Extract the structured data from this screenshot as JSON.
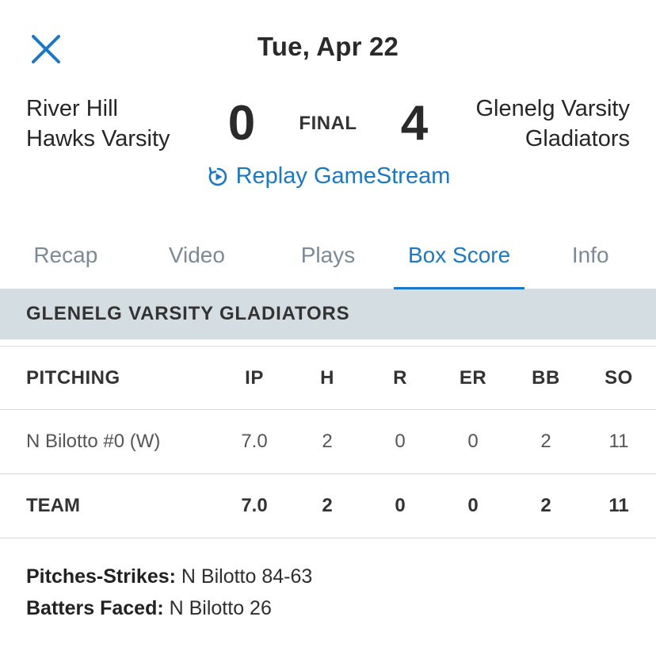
{
  "header": {
    "close_icon": "close-icon",
    "date": "Tue, Apr 22"
  },
  "game": {
    "away": {
      "line1": "River Hill",
      "line2": "Hawks Varsity",
      "score": "0"
    },
    "home": {
      "line1": "Glenelg Varsity",
      "line2": "Gladiators",
      "score": "4"
    },
    "status": "FINAL",
    "replay_label": "Replay GameStream",
    "replay_icon": "replay-icon"
  },
  "tabs": [
    {
      "label": "Recap"
    },
    {
      "label": "Video"
    },
    {
      "label": "Plays"
    },
    {
      "label": "Box Score"
    },
    {
      "label": "Info"
    }
  ],
  "active_tab": "Box Score",
  "section": {
    "title": "GLENELG VARSITY GLADIATORS"
  },
  "pitching": {
    "columns": [
      "PITCHING",
      "IP",
      "H",
      "R",
      "ER",
      "BB",
      "SO"
    ],
    "rows": [
      [
        "N Bilotto #0 (W)",
        "7.0",
        "2",
        "0",
        "0",
        "2",
        "11"
      ]
    ],
    "team": [
      "TEAM",
      "7.0",
      "2",
      "0",
      "0",
      "2",
      "11"
    ]
  },
  "notes": [
    {
      "label": "Pitches-Strikes:",
      "value": " N Bilotto 84-63"
    },
    {
      "label": "Batters Faced:",
      "value": " N Bilotto 26"
    }
  ],
  "colors": {
    "accent": "#1a78c8",
    "section_bg": "#d4dde2",
    "tab_inactive": "#7b8a96"
  }
}
